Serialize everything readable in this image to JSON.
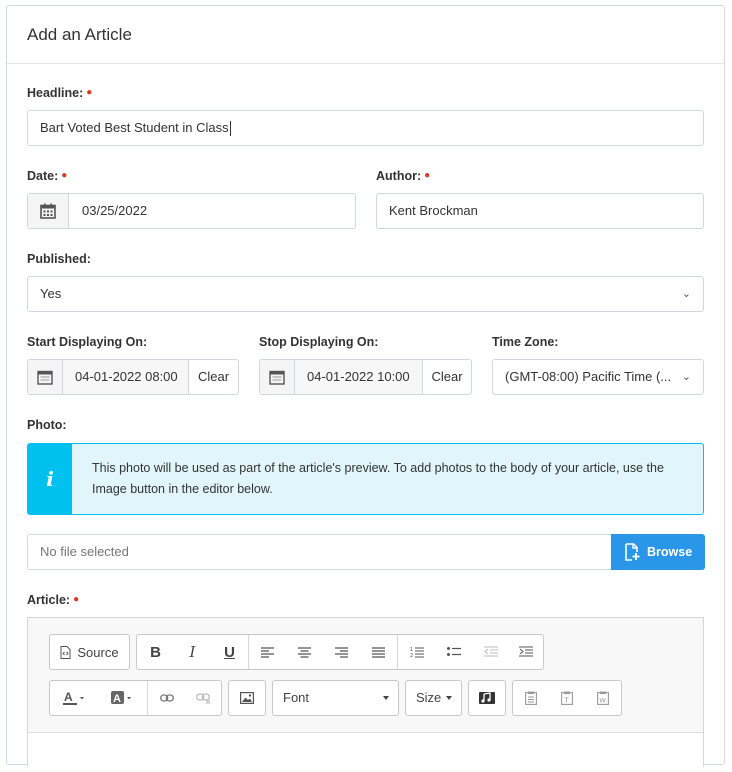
{
  "card": {
    "title": "Add an Article"
  },
  "headline": {
    "label": "Headline:",
    "value": "Bart Voted Best Student in Class"
  },
  "date": {
    "label": "Date:",
    "value": "03/25/2022"
  },
  "author": {
    "label": "Author:",
    "value": "Kent Brockman"
  },
  "published": {
    "label": "Published:",
    "value": "Yes"
  },
  "start_display": {
    "label": "Start Displaying On:",
    "value": "04-01-2022 08:00",
    "clear_label": "Clear"
  },
  "stop_display": {
    "label": "Stop Displaying On:",
    "value": "04-01-2022 10:00",
    "clear_label": "Clear"
  },
  "timezone": {
    "label": "Time Zone:",
    "value": "(GMT-08:00) Pacific Time (..."
  },
  "photo": {
    "label": "Photo:",
    "info_icon": "i",
    "info_text": "This photo will be used as part of the article's preview. To add photos to the body of your article, use the Image button in the editor below.",
    "file_placeholder": "No file selected",
    "browse_label": "Browse"
  },
  "article": {
    "label": "Article:",
    "toolbar": {
      "source_label": "Source",
      "font_label": "Font",
      "size_label": "Size",
      "icons": [
        "source-icon",
        "bold-icon",
        "italic-icon",
        "underline-icon",
        "align-left-icon",
        "align-center-icon",
        "align-right-icon",
        "justify-icon",
        "numbered-list-icon",
        "bullet-list-icon",
        "outdent-icon",
        "indent-icon",
        "text-color-icon",
        "background-color-icon",
        "link-icon",
        "unlink-icon",
        "image-icon",
        "audio-icon",
        "paste-icon",
        "paste-text-icon",
        "paste-word-icon"
      ]
    }
  },
  "colors": {
    "required": "#d73925",
    "info_border": "#00c0ef",
    "info_bg": "#e0f6fb",
    "browse": "#2a96e8"
  }
}
